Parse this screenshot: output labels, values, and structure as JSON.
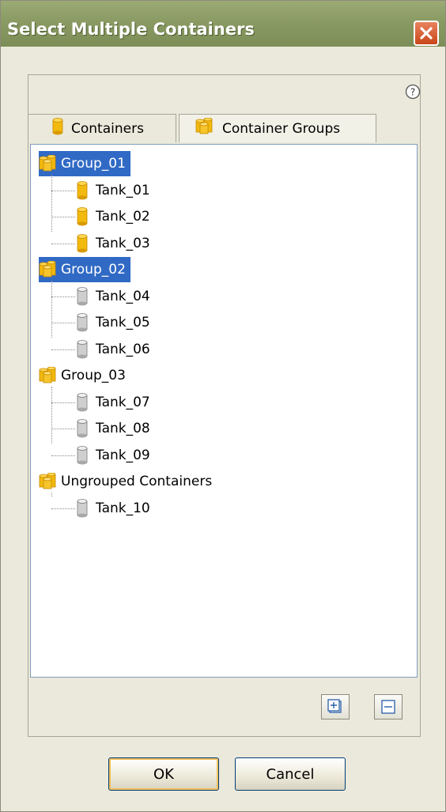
{
  "window": {
    "title": "Select Multiple Containers"
  },
  "tabs": [
    {
      "label": "Containers",
      "icon": "cylinder-icon"
    },
    {
      "label": "Container Groups",
      "icon": "group-icon"
    }
  ],
  "tree": [
    {
      "label": "Group_01",
      "selected": true,
      "children": [
        "Tank_01",
        "Tank_02",
        "Tank_03"
      ],
      "childSelected": true
    },
    {
      "label": "Group_02",
      "selected": true,
      "children": [
        "Tank_04",
        "Tank_05",
        "Tank_06"
      ],
      "childSelected": false
    },
    {
      "label": "Group_03",
      "selected": false,
      "children": [
        "Tank_07",
        "Tank_08",
        "Tank_09"
      ],
      "childSelected": false
    },
    {
      "label": "Ungrouped Containers",
      "selected": false,
      "children": [
        "Tank_10"
      ],
      "childSelected": false
    }
  ],
  "buttons": {
    "ok": "OK",
    "cancel": "Cancel"
  },
  "colors": {
    "title_bar": "#8a9a63",
    "selection": "#316ac5",
    "tank_selected": "#f2b90e",
    "tank_unselected": "#c8c8c8"
  }
}
